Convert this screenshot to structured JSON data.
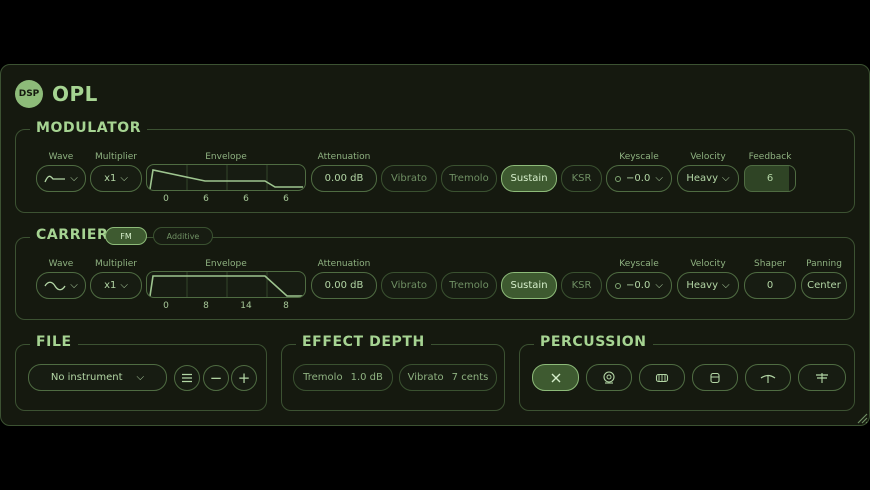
{
  "app": {
    "logo": "DSP",
    "title": "OPL"
  },
  "modulator": {
    "title": "MODULATOR",
    "labels": {
      "wave": "Wave",
      "multiplier": "Multiplier",
      "envelope": "Envelope",
      "attenuation": "Attenuation",
      "keyscale": "Keyscale",
      "velocity": "Velocity",
      "feedback": "Feedback"
    },
    "multiplier": "x1",
    "envelope_values": [
      "0",
      "6",
      "6",
      "6"
    ],
    "attenuation": "0.00 dB",
    "toggles": {
      "vibrato": "Vibrato",
      "tremolo": "Tremolo",
      "sustain": "Sustain",
      "ksr": "KSR"
    },
    "keyscale": "−0.0",
    "velocity": "Heavy",
    "feedback": "6"
  },
  "carrier": {
    "title": "CARRIER",
    "modes": {
      "fm": "FM",
      "additive": "Additive"
    },
    "labels": {
      "wave": "Wave",
      "multiplier": "Multiplier",
      "envelope": "Envelope",
      "attenuation": "Attenuation",
      "keyscale": "Keyscale",
      "velocity": "Velocity",
      "shaper": "Shaper",
      "panning": "Panning"
    },
    "multiplier": "x1",
    "envelope_values": [
      "0",
      "8",
      "14",
      "8"
    ],
    "attenuation": "0.00 dB",
    "toggles": {
      "vibrato": "Vibrato",
      "tremolo": "Tremolo",
      "sustain": "Sustain",
      "ksr": "KSR"
    },
    "keyscale": "−0.0",
    "velocity": "Heavy",
    "shaper": "0",
    "panning": "Center"
  },
  "file": {
    "title": "FILE",
    "instrument": "No instrument",
    "menu_icon": "menu-icon",
    "remove_icon": "minus-icon",
    "add_icon": "plus-icon",
    "remove_symbol": "−",
    "add_symbol": "+"
  },
  "effect_depth": {
    "title": "EFFECT DEPTH",
    "tremolo_label": "Tremolo",
    "tremolo_value": "1.0 dB",
    "vibrato_label": "Vibrato",
    "vibrato_value": "7 cents"
  },
  "percussion": {
    "title": "PERCUSSION",
    "items": [
      "close-icon",
      "bass-drum-icon",
      "snare-drum-icon",
      "tom-icon",
      "cymbal-icon",
      "hi-hat-icon"
    ]
  },
  "colors": {
    "accent": "#8dbb79",
    "active_bg": "#3e5a30",
    "panel_bg": "#15190f",
    "border": "#3c5232"
  }
}
